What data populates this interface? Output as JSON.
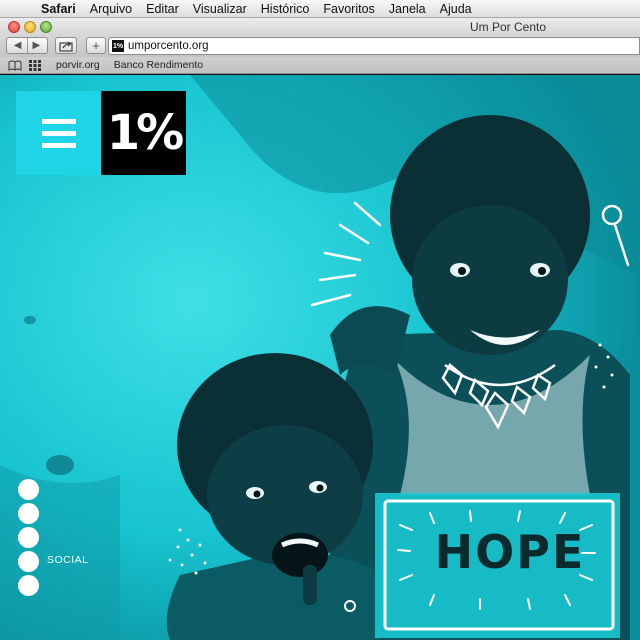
{
  "menubar": {
    "apple_icon": "apple-logo-icon",
    "items": [
      "Safari",
      "Arquivo",
      "Editar",
      "Visualizar",
      "Histórico",
      "Favoritos",
      "Janela",
      "Ajuda"
    ]
  },
  "window": {
    "title": "Um Por Cento"
  },
  "toolbar": {
    "back_icon": "◀",
    "forward_icon": "▶",
    "plus_label": "+",
    "favicon_text": "1%",
    "url": "umporcento.org"
  },
  "bookmarks": {
    "items": [
      "porvir.org",
      "Banco Rendimento"
    ]
  },
  "site": {
    "logo_text": "1%",
    "social_label": "SOCIAL",
    "sign_text": "HOPE",
    "photo_subject": "two smiling girls with braided hair, cyan duotone"
  },
  "colors": {
    "accent_cyan": "#1fd4e4",
    "photo_cyan": "#16c7d2",
    "logo_black": "#000000"
  }
}
